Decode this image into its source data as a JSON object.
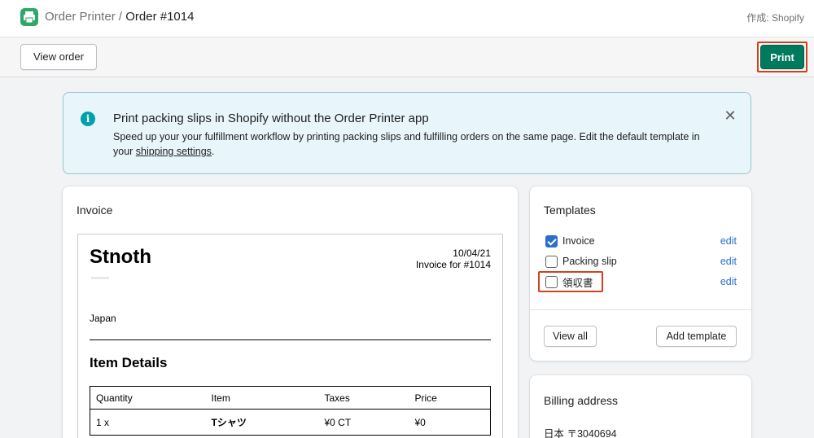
{
  "topbar": {
    "app_name": "Order Printer",
    "separator": "/",
    "order": "Order #1014",
    "made_by": "作成: Shopify"
  },
  "actions": {
    "view_order": "View order",
    "print": "Print"
  },
  "banner": {
    "icon": "i",
    "title": "Print packing slips in Shopify without the Order Printer app",
    "body_pre": "Speed up your your fulfillment workflow by printing packing slips and fulfilling orders on the same page. Edit the default template in your ",
    "link": "shipping settings",
    "body_post": ".",
    "close": "✕"
  },
  "invoice": {
    "card_title": "Invoice",
    "shop_name": "Stnoth",
    "date": "10/04/21",
    "invoice_for": "Invoice for #1014",
    "country": "Japan",
    "items_heading": "Item Details",
    "columns": [
      "Quantity",
      "Item",
      "Taxes",
      "Price"
    ],
    "rows": [
      {
        "quantity": "1 x",
        "item": "Tシャツ",
        "taxes": "¥0 CT",
        "price": "¥0"
      }
    ]
  },
  "templates": {
    "title": "Templates",
    "items": [
      {
        "label": "Invoice",
        "checked": true,
        "edit": "edit"
      },
      {
        "label": "Packing slip",
        "checked": false,
        "edit": "edit"
      },
      {
        "label": "領収書",
        "checked": false,
        "edit": "edit"
      }
    ],
    "view_all": "View all",
    "add_template": "Add template"
  },
  "billing": {
    "title": "Billing address",
    "line1": "日本 〒3040694"
  },
  "colors": {
    "primary": "#007a5c",
    "highlight": "#d0421b",
    "link": "#2c6ecb",
    "banner_bg": "#e8f5fa",
    "info": "#00a0ac"
  },
  "icons": {
    "app": "printer-icon",
    "info": "info-icon",
    "close": "close-icon"
  }
}
